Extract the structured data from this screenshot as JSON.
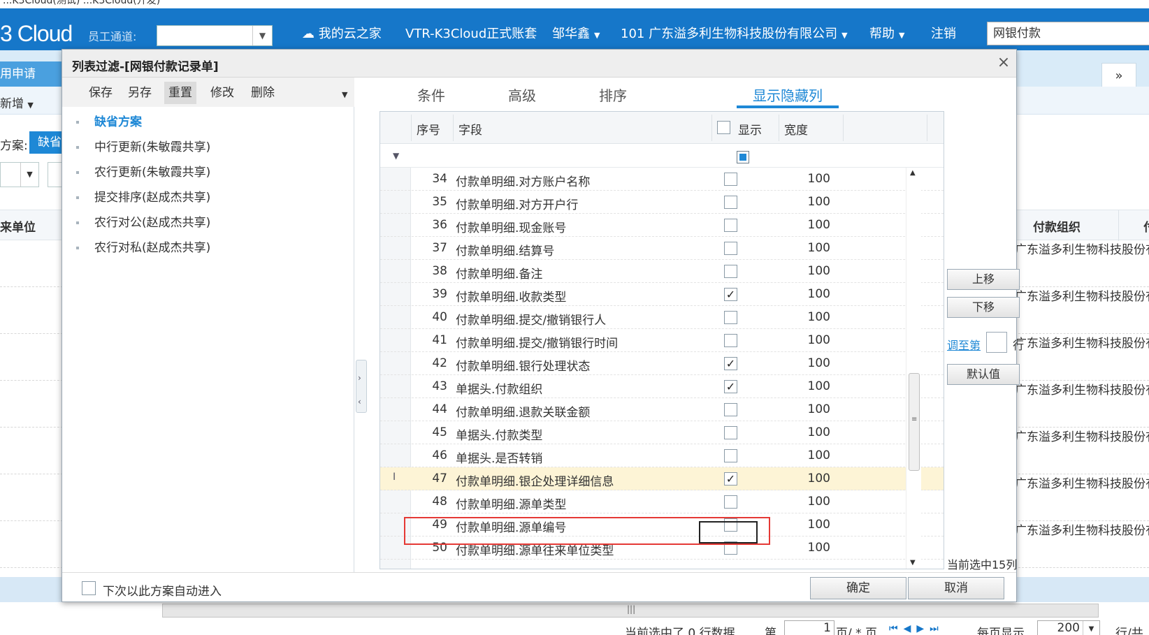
{
  "browser": {
    "tab_strip_text": "...K3Cloud(测试) ...K3Cloud(开发)"
  },
  "topbar": {
    "logo": "3 Cloud",
    "employee_channel_label": "员工通道:",
    "employee_channel_value": "",
    "nav": [
      {
        "label": "我的云之家",
        "icon": "cloud-icon"
      },
      {
        "label": "VTR-K3Cloud正式账套"
      },
      {
        "label": "邹华鑫",
        "dropdown": true
      },
      {
        "label": "101  广东溢多利生物科技股份有限公司",
        "dropdown": true
      },
      {
        "label": "帮助",
        "dropdown": true
      },
      {
        "label": "注销"
      }
    ],
    "search_value": "网银付款"
  },
  "background": {
    "app_tab": "用申请",
    "new_button": "新增",
    "scheme_label": "方案:",
    "scheme_chip": "缺省",
    "grid_columns": [
      "来单位",
      "付款组织",
      "付"
    ],
    "org_cell_text": "广东溢多利生物科技股份有限公",
    "pager": {
      "status": "当前选中了  0 行数据",
      "page_label": "第",
      "page_value": "1",
      "page_of": "页/ *  页",
      "page_size_label": "每页显示",
      "page_size": "200",
      "rows_label": "行/共"
    }
  },
  "dialog": {
    "title": "列表过滤-[网银付款记录单]",
    "left_toolbar": [
      {
        "label": "保存"
      },
      {
        "label": "另存"
      },
      {
        "label": "重置",
        "active": true
      },
      {
        "label": "修改"
      },
      {
        "label": "删除"
      }
    ],
    "schemes": [
      {
        "label": "缺省方案",
        "selected": true
      },
      {
        "label": "中行更新(朱敏霞共享)"
      },
      {
        "label": "农行更新(朱敏霞共享)"
      },
      {
        "label": "提交排序(赵成杰共享)"
      },
      {
        "label": "农行对公(赵成杰共享)"
      },
      {
        "label": "农行对私(赵成杰共享)"
      }
    ],
    "tabs": [
      {
        "label": "条件"
      },
      {
        "label": "高级"
      },
      {
        "label": "排序"
      },
      {
        "label": "显示隐藏列",
        "active": true
      }
    ],
    "table": {
      "headers": {
        "seq": "序号",
        "field": "字段",
        "show": "显示",
        "width": "宽度"
      },
      "rows": [
        {
          "seq": "34",
          "field": "付款单明细.对方账户名称",
          "checked": false,
          "width": "100"
        },
        {
          "seq": "35",
          "field": "付款单明细.对方开户行",
          "checked": false,
          "width": "100"
        },
        {
          "seq": "36",
          "field": "付款单明细.现金账号",
          "checked": false,
          "width": "100"
        },
        {
          "seq": "37",
          "field": "付款单明细.结算号",
          "checked": false,
          "width": "100"
        },
        {
          "seq": "38",
          "field": "付款单明细.备注",
          "checked": false,
          "width": "100"
        },
        {
          "seq": "39",
          "field": "付款单明细.收款类型",
          "checked": true,
          "width": "100"
        },
        {
          "seq": "40",
          "field": "付款单明细.提交/撤销银行人",
          "checked": false,
          "width": "100"
        },
        {
          "seq": "41",
          "field": "付款单明细.提交/撤销银行时间",
          "checked": false,
          "width": "100"
        },
        {
          "seq": "42",
          "field": "付款单明细.银行处理状态",
          "checked": true,
          "width": "100"
        },
        {
          "seq": "43",
          "field": "单据头.付款组织",
          "checked": true,
          "width": "100"
        },
        {
          "seq": "44",
          "field": "付款单明细.退款关联金额",
          "checked": false,
          "width": "100"
        },
        {
          "seq": "45",
          "field": "单据头.付款类型",
          "checked": false,
          "width": "100"
        },
        {
          "seq": "46",
          "field": "单据头.是否转销",
          "checked": false,
          "width": "100"
        },
        {
          "seq": "47",
          "field": "付款单明细.银企处理详细信息",
          "checked": true,
          "width": "100",
          "current": true
        },
        {
          "seq": "48",
          "field": "付款单明细.源单类型",
          "checked": false,
          "width": "100"
        },
        {
          "seq": "49",
          "field": "付款单明细.源单编号",
          "checked": false,
          "width": "100"
        },
        {
          "seq": "50",
          "field": "付款单明细.源单往来单位类型",
          "checked": false,
          "width": "100"
        }
      ]
    },
    "side": {
      "move_up": "上移",
      "move_down": "下移",
      "goto_link": "调至第",
      "goto_suffix": "行",
      "default_value": "默认值",
      "selected_count": "当前选中15列"
    },
    "footer": {
      "auto_enter_label": "下次以此方案自动进入",
      "ok": "确定",
      "cancel": "取消"
    }
  }
}
